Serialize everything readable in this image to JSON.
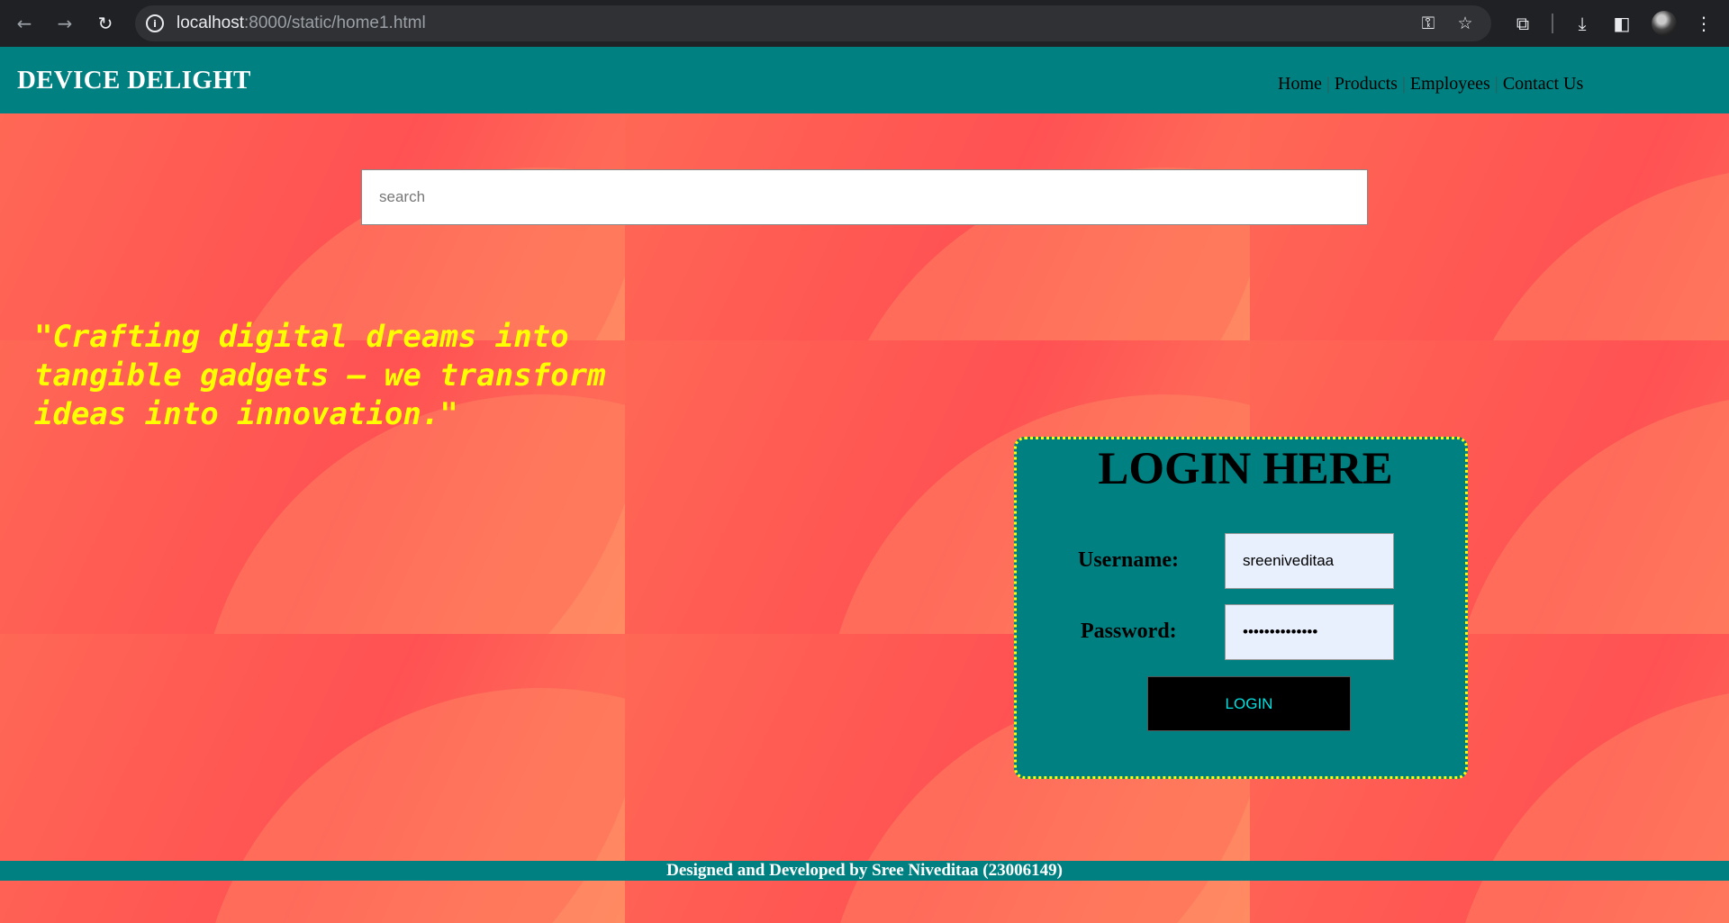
{
  "browser": {
    "url_host": "localhost",
    "url_path": ":8000/static/home1.html",
    "icons": {
      "back": "arrow-left-icon",
      "forward": "arrow-right-icon",
      "reload": "reload-icon",
      "site_info": "info-icon",
      "password": "key-icon",
      "bookmark": "star-icon",
      "extensions": "puzzle-icon",
      "downloads": "download-icon",
      "side_panel": "side-panel-icon",
      "menu": "kebab-menu-icon"
    }
  },
  "header": {
    "brand": "DEVICE DELIGHT",
    "nav": [
      {
        "label": "Home"
      },
      {
        "label": "Products"
      },
      {
        "label": "Employees"
      },
      {
        "label": "Contact Us"
      }
    ],
    "separator": "|"
  },
  "search": {
    "placeholder": "search",
    "value": ""
  },
  "quote": "\"Crafting digital dreams into tangible gadgets – we transform ideas into innovation.\"",
  "login": {
    "title": "LOGIN HERE",
    "username_label": "Username:",
    "username_value": "sreeniveditaa",
    "password_label": "Password:",
    "password_value": "••••••••••••••",
    "button_label": "LOGIN"
  },
  "footer": {
    "text": "Designed and Developed by Sree Niveditaa (23006149)"
  },
  "colors": {
    "teal": "#008080",
    "quote_yellow": "#ffff00",
    "background_coral": "#ff5c5a"
  }
}
